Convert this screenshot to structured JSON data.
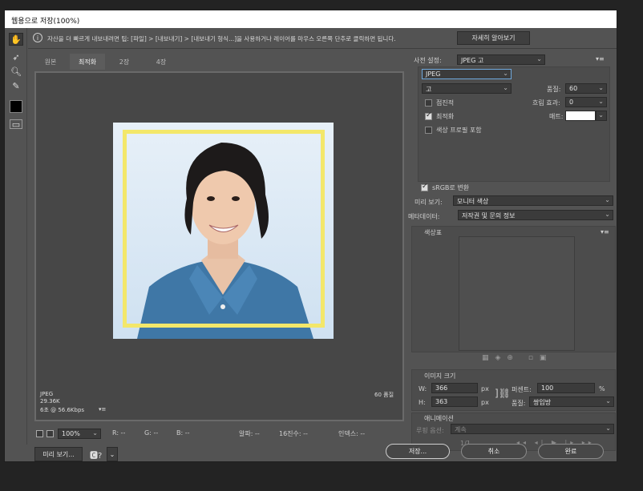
{
  "window": {
    "title": "웹용으로 저장(100%)"
  },
  "info": {
    "message": "자산을 더 빠르게 내보내려면 팁: [파일] > [내보내기] > [내보내기 형식...]을 사용하거나 레이어를 마우스 오른쪽 단추로 클릭하면 됩니다.",
    "learn_more": "자세히 알아보기"
  },
  "tabs": [
    {
      "label": "원본"
    },
    {
      "label": "최적화"
    },
    {
      "label": "2장"
    },
    {
      "label": "4장"
    }
  ],
  "preview": {
    "format": "JPEG",
    "size": "29.36K",
    "time": "6초 @ 56.6Kbps",
    "quality_label": "60 품질",
    "menu": "▾≡"
  },
  "status": {
    "zoom": "100%",
    "r": "R: --",
    "g": "G: --",
    "b": "B: --",
    "alpha": "알파: --",
    "hex": "16진수: --",
    "index": "인덱스: --"
  },
  "right": {
    "preset_label": "사전 설정:",
    "preset_value": "JPEG 고",
    "format": "JPEG",
    "quality_preset": "고",
    "quality_label": "품질:",
    "quality_value": "60",
    "progressive": "점진적",
    "blur_label": "흐림 효과:",
    "blur_value": "0",
    "optimized": "최적화",
    "matte_label": "매트:",
    "embed_profile": "색상 프로필 포함",
    "srgb": "sRGB로 변환",
    "preview_label": "미리 보기:",
    "preview_value": "모니터 색상",
    "metadata_label": "메타데이터:",
    "metadata_value": "저작권 및 문의 정보",
    "color_table": "색상표",
    "image_size": "이미지 크기",
    "w_label": "W:",
    "w_value": "366",
    "h_label": "H:",
    "h_value": "363",
    "px": "px",
    "percent_label": "퍼센트:",
    "percent_value": "100",
    "percent_unit": "%",
    "resample_label": "품질:",
    "resample_value": "쌍입방",
    "animation": "애니메이션",
    "loop_label": "루핑 옵션:",
    "loop_value": "계속",
    "frame_counter": "1/1"
  },
  "bottom": {
    "preview_btn": "미리 보기...",
    "save": "저장...",
    "cancel": "취소",
    "done": "완료"
  },
  "colors": {
    "accent": "#f3e76a",
    "shirt": "#3f77a6"
  }
}
